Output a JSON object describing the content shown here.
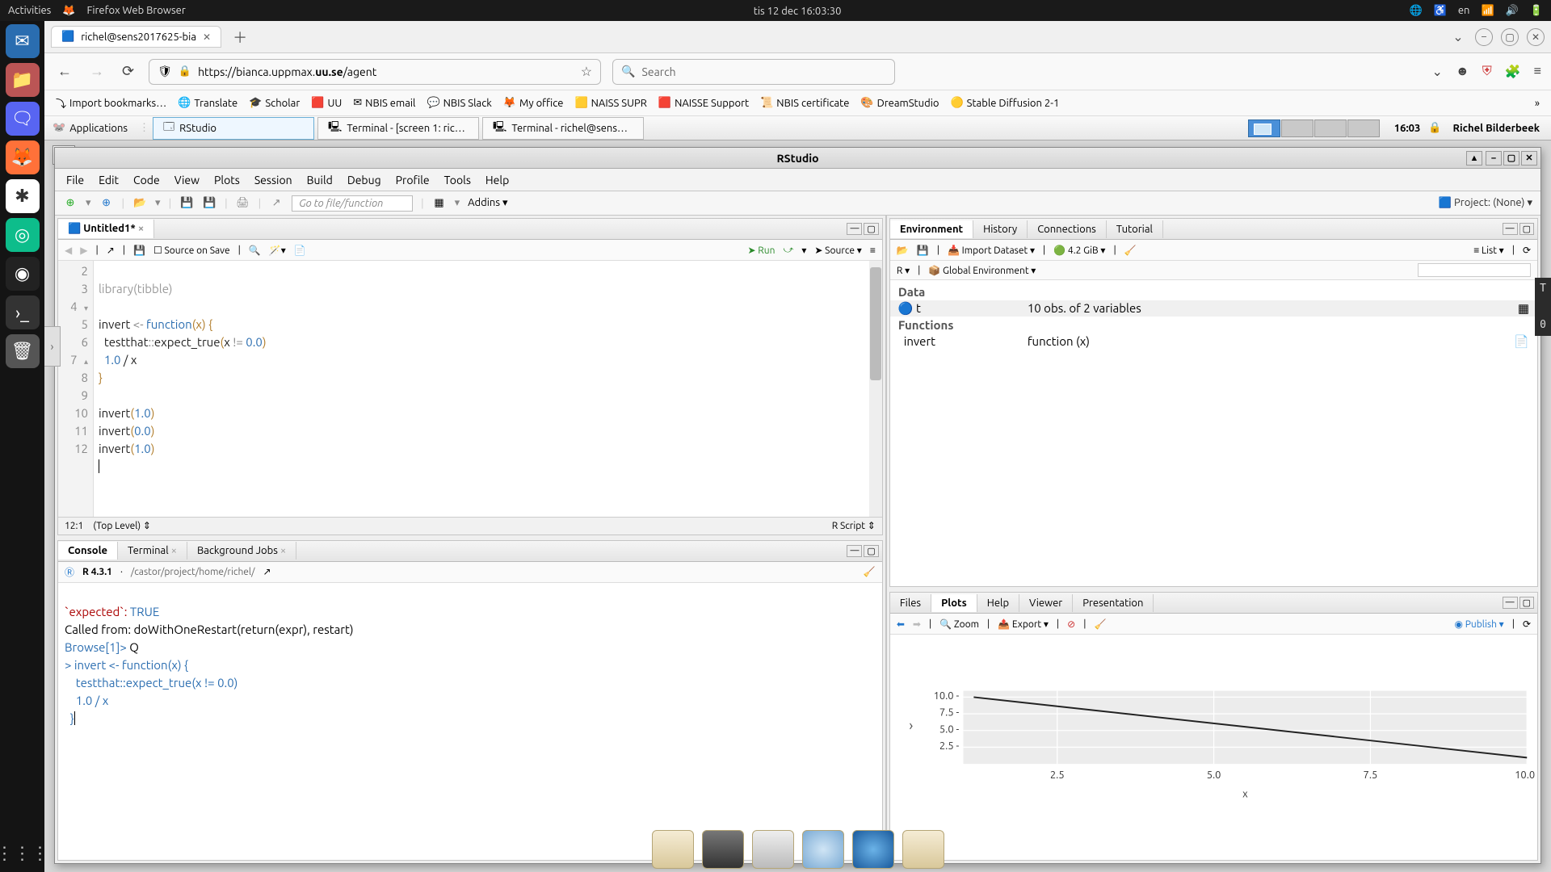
{
  "gnome": {
    "activities": "Activities",
    "app": "Firefox Web Browser",
    "datetime": "tis 12 dec  16:03:30",
    "lang": "en"
  },
  "browser": {
    "tab_title": "richel@sens2017625-bia",
    "url_host": "https://bianca.uppmax.",
    "url_bold": "uu.se",
    "url_path": "/agent",
    "search_placeholder": "Search"
  },
  "bookmarks": [
    "Import bookmarks…",
    "Translate",
    "Scholar",
    "UU",
    "NBIS email",
    "NBIS Slack",
    "My office",
    "NAISS SUPR",
    "NAISSE Support",
    "NBIS certificate",
    "DreamStudio",
    "Stable Diffusion 2-1"
  ],
  "inner_taskbar": {
    "apps": "Applications",
    "tasks": [
      "RStudio",
      "Terminal - [screen 1: ric…",
      "Terminal - richel@sens…"
    ],
    "clock": "16:03",
    "user": "Richel Bilderbeek"
  },
  "rstudio": {
    "title": "RStudio",
    "menu": [
      "File",
      "Edit",
      "Code",
      "View",
      "Plots",
      "Session",
      "Build",
      "Debug",
      "Profile",
      "Tools",
      "Help"
    ],
    "goto_placeholder": "Go to file/function",
    "addins": "Addins",
    "project": "Project: (None)"
  },
  "source": {
    "tab": "Untitled1*",
    "source_on_save": "Source on Save",
    "run": "Run",
    "source_btn": "Source",
    "lines": {
      "l2": "library(tibble)",
      "l4a": "invert ",
      "l4b": "<-",
      "l4c": " function",
      "l4d": "(x) {",
      "l5a": "  testthat",
      "l5b": "::expect_true(",
      "l5c": "x != ",
      "l5d": "0.0",
      "l5e": ")",
      "l6a": "  ",
      "l6b": "1.0",
      "l6c": " / x",
      "l7": "}",
      "l9a": "invert(",
      "l9b": "1.0",
      "l9c": ")",
      "l10a": "invert(",
      "l10b": "0.0",
      "l10c": ")",
      "l11a": "invert(",
      "l11b": "1.0",
      "l11c": ")"
    },
    "status_pos": "12:1",
    "status_scope": "(Top Level)",
    "status_type": "R Script"
  },
  "console": {
    "tabs": [
      "Console",
      "Terminal",
      "Background Jobs"
    ],
    "info_ver": "R 4.3.1",
    "info_path": "/castor/project/home/richel/",
    "lines": {
      "a": "`expected`: ",
      "a2": "TRUE",
      "b": "Called from: doWithOneRestart(return(expr), restart)",
      "c": "Browse[1]> ",
      "c2": "Q",
      "d": "> ",
      "d2": "invert <- function(x) {",
      "e": "    testthat::expect_true(x != 0.0)",
      "f": "    1.0 / x",
      "g": "  }"
    }
  },
  "env": {
    "tabs": [
      "Environment",
      "History",
      "Connections",
      "Tutorial"
    ],
    "import": "Import Dataset",
    "mem": "4.2 GiB",
    "list": "List",
    "scope_r": "R",
    "scope_env": "Global Environment",
    "data_hdr": "Data",
    "func_hdr": "Functions",
    "rows": [
      {
        "name": "t",
        "value": "10 obs. of 2 variables"
      },
      {
        "name": "invert",
        "value": "function (x)"
      }
    ]
  },
  "plots": {
    "tabs": [
      "Files",
      "Plots",
      "Help",
      "Viewer",
      "Presentation"
    ],
    "zoom": "Zoom",
    "export": "Export",
    "publish": "Publish"
  },
  "chart_data": {
    "type": "line",
    "x": [
      1,
      2,
      3,
      4,
      5,
      6,
      7,
      8,
      9,
      10
    ],
    "y": [
      10,
      9,
      8,
      7,
      6,
      5,
      4,
      3,
      2,
      1
    ],
    "xlabel": "x",
    "ylabel": "",
    "xlim": [
      1,
      11
    ],
    "ylim": [
      0,
      11
    ],
    "xticks": [
      2.5,
      5.0,
      7.5,
      10.0
    ],
    "yticks": [
      2.5,
      5.0,
      7.5,
      10.0
    ]
  }
}
